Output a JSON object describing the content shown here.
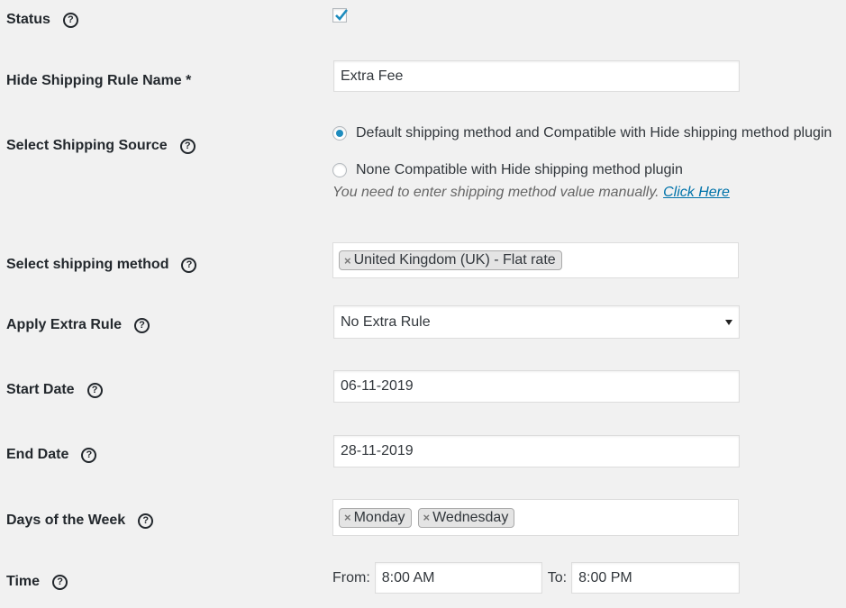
{
  "status": {
    "label": "Status",
    "checked": true
  },
  "rule_name": {
    "label": "Hide Shipping Rule Name *",
    "value": "Extra Fee"
  },
  "shipping_source": {
    "label": "Select Shipping Source",
    "options": [
      {
        "label": "Default shipping method and Compatible with Hide shipping method plugin",
        "selected": true
      },
      {
        "label": "None Compatible with Hide shipping method plugin",
        "selected": false
      }
    ],
    "note": "You need to enter shipping method value manually.",
    "note_link": "Click Here"
  },
  "shipping_method": {
    "label": "Select shipping method",
    "tags": [
      "United Kingdom (UK) - Flat rate"
    ]
  },
  "extra_rule": {
    "label": "Apply Extra Rule",
    "value": "No Extra Rule"
  },
  "start_date": {
    "label": "Start Date",
    "value": "06-11-2019"
  },
  "end_date": {
    "label": "End Date",
    "value": "28-11-2019"
  },
  "days": {
    "label": "Days of the Week",
    "tags": [
      "Monday",
      "Wednesday"
    ]
  },
  "time": {
    "label": "Time",
    "from_label": "From:",
    "from_value": "8:00 AM",
    "to_label": "To:",
    "to_value": "8:00 PM"
  },
  "icons": {
    "help": "help-circle-icon",
    "check": "checkmark-icon",
    "remove": "remove-x-icon",
    "dropdown": "chevron-down-icon"
  },
  "colors": {
    "accent": "#1e8cbe",
    "link": "#0073aa",
    "background": "#f1f1f1"
  }
}
